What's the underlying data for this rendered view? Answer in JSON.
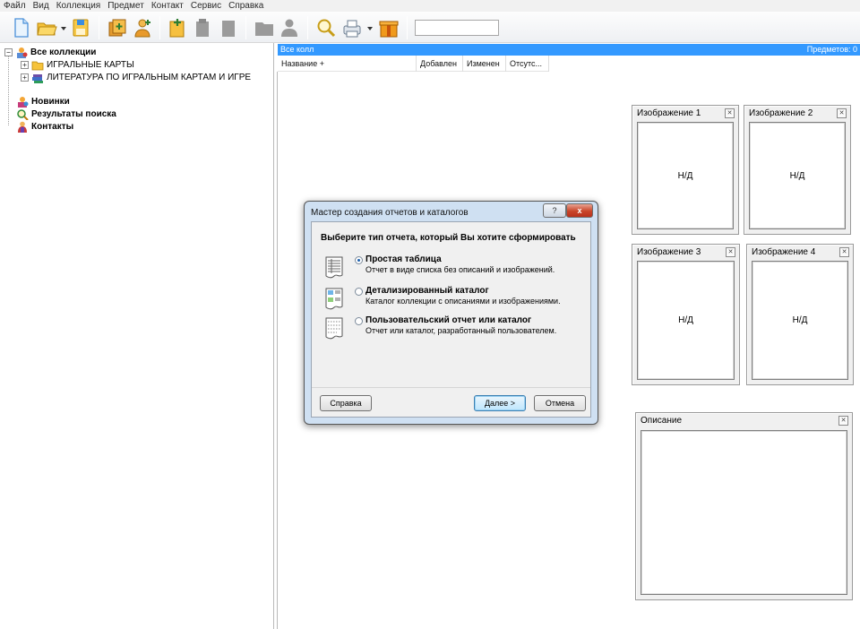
{
  "menu": [
    "Файл",
    "Вид",
    "Коллекция",
    "Предмет",
    "Контакт",
    "Сервис",
    "Справка"
  ],
  "toolbar": {
    "icons": [
      "new-file-icon",
      "open-folder-icon",
      "save-disk-icon",
      "collection-add-icon",
      "person-add-icon",
      "item-add-icon",
      "item-edit-icon",
      "item-delete-icon",
      "folder-gray-icon",
      "contact-gray-icon",
      "search-magnifier-icon",
      "print-icon",
      "gift-box-icon"
    ],
    "search_value": ""
  },
  "tree": [
    {
      "label": "Все коллекции",
      "bold": true,
      "expander": "−"
    },
    {
      "label": "ИГРАЛЬНЫЕ КАРТЫ",
      "bold": false,
      "expander": "+"
    },
    {
      "label": "ЛИТЕРАТУРА ПО ИГРАЛЬНЫМ КАРТАМ И ИГРЕ",
      "bold": false,
      "expander": "+"
    },
    {
      "label": "Новинки",
      "bold": true
    },
    {
      "label": "Результаты поиска",
      "bold": true
    },
    {
      "label": "Контакты",
      "bold": true
    }
  ],
  "list": {
    "header_title": "Все колл",
    "count_label": "Предметов: 0",
    "columns": [
      "Название +",
      "Добавлен",
      "Изменен",
      "Отсутс..."
    ]
  },
  "image_panels": [
    {
      "title": "Изображение 1",
      "placeholder": "Н/Д"
    },
    {
      "title": "Изображение 2",
      "placeholder": "Н/Д"
    },
    {
      "title": "Изображение 3",
      "placeholder": "Н/Д"
    },
    {
      "title": "Изображение 4",
      "placeholder": "Н/Д"
    }
  ],
  "description_panel": {
    "title": "Описание"
  },
  "dialog": {
    "title": "Мастер создания отчетов и каталогов",
    "help_glyph": "?",
    "close_glyph": "x",
    "heading": "Выберите тип отчета, который Вы хотите сформировать",
    "options": [
      {
        "title": "Простая таблица",
        "desc": "Отчет в виде списка без описаний и изображений.",
        "selected": true
      },
      {
        "title": "Детализированный каталог",
        "desc": "Каталог коллекции с описаниями и изображениями.",
        "selected": false
      },
      {
        "title": "Пользовательский отчет или каталог",
        "desc": "Отчет или каталог, разработанный пользователем.",
        "selected": false
      }
    ],
    "help_button": "Справка",
    "next_button": "Далее >",
    "cancel_button": "Отмена"
  }
}
